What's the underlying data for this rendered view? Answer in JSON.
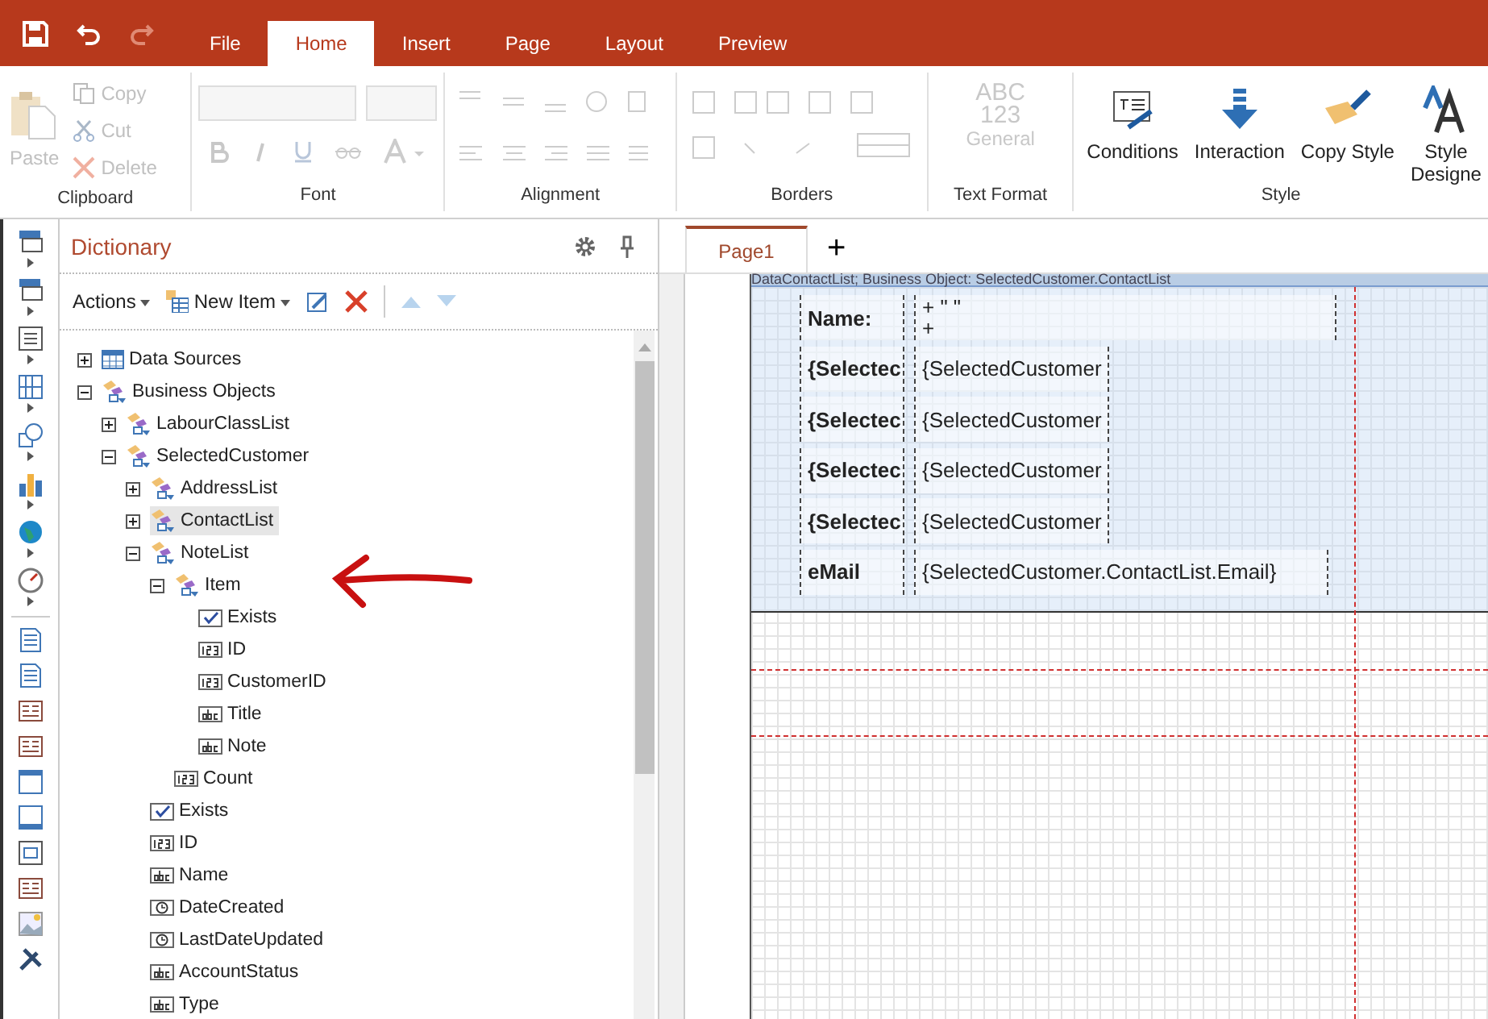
{
  "quick_access": {
    "redo_disabled": true
  },
  "tabs": [
    {
      "label": "File",
      "selected": false
    },
    {
      "label": "Home",
      "selected": true
    },
    {
      "label": "Insert",
      "selected": false
    },
    {
      "label": "Page",
      "selected": false
    },
    {
      "label": "Layout",
      "selected": false
    },
    {
      "label": "Preview",
      "selected": false
    }
  ],
  "ribbon": {
    "clipboard": {
      "title": "Clipboard",
      "paste": {
        "label": "Paste",
        "disabled": true
      },
      "items": [
        {
          "label": "Copy",
          "kind": "copy",
          "disabled": true
        },
        {
          "label": "Cut",
          "kind": "cut",
          "disabled": true
        },
        {
          "label": "Delete",
          "kind": "delete",
          "disabled": true
        }
      ]
    },
    "font": {
      "title": "Font"
    },
    "alignment": {
      "title": "Alignment"
    },
    "borders": {
      "title": "Borders"
    },
    "text_format": {
      "title": "Text Format",
      "lines": [
        "ABC",
        "123",
        "General"
      ]
    },
    "style": {
      "title": "Style",
      "buttons": [
        {
          "label": "Conditions",
          "kind": "conditions",
          "disabled": false
        },
        {
          "label": "Interaction",
          "kind": "interaction",
          "disabled": false
        },
        {
          "label": "Copy Style",
          "kind": "brush",
          "disabled": false
        },
        {
          "label": "Style Designe",
          "kind": "designer",
          "disabled": false
        }
      ]
    }
  },
  "dictionary": {
    "title": "Dictionary",
    "actions": "Actions",
    "new_item": "New Item",
    "tree": [
      {
        "label": "Data Sources",
        "kind": "datasource",
        "expanded": false,
        "selected": false
      },
      {
        "label": "Business Objects",
        "kind": "object",
        "expanded": true,
        "selected": false,
        "children": [
          {
            "label": "LabourClassList",
            "kind": "object",
            "expanded": false,
            "selected": false
          },
          {
            "label": "SelectedCustomer",
            "kind": "object",
            "expanded": true,
            "selected": false,
            "children": [
              {
                "label": "AddressList",
                "kind": "object",
                "expanded": false,
                "selected": false
              },
              {
                "label": "ContactList",
                "kind": "object",
                "expanded": false,
                "selected": true
              },
              {
                "label": "NoteList",
                "kind": "object",
                "expanded": true,
                "selected": false,
                "children": [
                  {
                    "label": "Item",
                    "kind": "object",
                    "expanded": true,
                    "selected": false,
                    "children": [
                      {
                        "label": "Exists",
                        "kind": "bool",
                        "selected": false
                      },
                      {
                        "label": "ID",
                        "kind": "number",
                        "selected": false
                      },
                      {
                        "label": "CustomerID",
                        "kind": "number",
                        "selected": false
                      },
                      {
                        "label": "Title",
                        "kind": "string",
                        "selected": false
                      },
                      {
                        "label": "Note",
                        "kind": "string",
                        "selected": false
                      }
                    ]
                  },
                  {
                    "label": "Count",
                    "kind": "number",
                    "selected": false
                  }
                ]
              },
              {
                "label": "Exists",
                "kind": "bool",
                "selected": false
              },
              {
                "label": "ID",
                "kind": "number",
                "selected": false
              },
              {
                "label": "Name",
                "kind": "string",
                "selected": false
              },
              {
                "label": "DateCreated",
                "kind": "datetime",
                "selected": false
              },
              {
                "label": "LastDateUpdated",
                "kind": "datetime",
                "selected": false
              },
              {
                "label": "AccountStatus",
                "kind": "string",
                "selected": false
              },
              {
                "label": "Type",
                "kind": "string",
                "selected": false
              }
            ]
          }
        ]
      }
    ]
  },
  "designer": {
    "pages": [
      {
        "label": "Page1",
        "selected": true
      }
    ],
    "add_page": "+",
    "band_title": "DataContactList; Business Object: SelectedCustomer.ContactList",
    "rows": [
      {
        "label": "Name:",
        "value_lines": [
          "+ \" \"",
          "+"
        ],
        "kind": "wide"
      },
      {
        "label": "{Selectec",
        "value_lines": [
          "{SelectedCustomer"
        ],
        "kind": "fit"
      },
      {
        "label": "{Selectec",
        "value_lines": [
          "{SelectedCustomer"
        ],
        "kind": "fit"
      },
      {
        "label": "{Selectec",
        "value_lines": [
          "{SelectedCustomer"
        ],
        "kind": "fit"
      },
      {
        "label": "{Selectec",
        "value_lines": [
          "{SelectedCustomer"
        ],
        "kind": "fit"
      },
      {
        "label": "eMail",
        "value_lines": [
          "{SelectedCustomer.ContactList.Email}"
        ],
        "kind": "wide"
      }
    ]
  }
}
